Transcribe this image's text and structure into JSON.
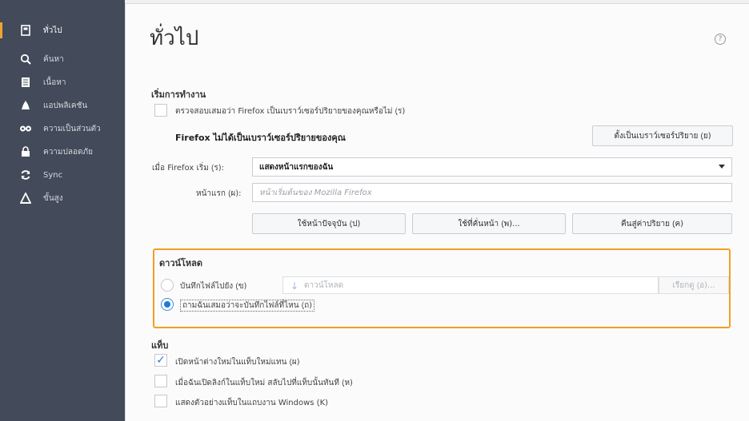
{
  "sidebar": {
    "items": [
      {
        "label": "ทั่วไป",
        "icon": "general-icon"
      },
      {
        "label": "ค้นหา",
        "icon": "search-icon"
      },
      {
        "label": "เนื้อหา",
        "icon": "content-icon"
      },
      {
        "label": "แอปพลิเคชัน",
        "icon": "applications-icon"
      },
      {
        "label": "ความเป็นส่วนตัว",
        "icon": "privacy-icon"
      },
      {
        "label": "ความปลอดภัย",
        "icon": "security-icon"
      },
      {
        "label": "Sync",
        "icon": "sync-icon"
      },
      {
        "label": "ขั้นสูง",
        "icon": "advanced-icon"
      }
    ]
  },
  "main": {
    "title": "ทั่วไป",
    "help": "?",
    "startup": {
      "title": "เริ่มการทำงาน",
      "check_default": "ตรวจสอบเสมอว่า Firefox เป็นเบราว์เซอร์ปริยายของคุณหรือไม่ (ฺร)",
      "not_default": "Firefox ไม่ได้เป็นเบราว์เซอร์ปริยายของคุณ",
      "make_default_button": "ตั้งเป็นเบราว์เซอร์ปริยาย (ฺย)",
      "when_starts_label": "เมื่อ Firefox เริ่ม (ฺร):",
      "when_starts_value": "แสดงหน้าแรกของฉัน",
      "homepage_label": "หน้าแรก (ฺผ):",
      "homepage_placeholder": "หน้าเริ่มต้นของ Mozilla Firefox",
      "use_current_button": "ใช้หน้าปัจจุบัน (ฺป)",
      "use_bookmark_button": "ใช้ที่คั่นหน้า (ฺพ)...",
      "restore_default_button": "คืนสู่ค่าปริยาย (ฺค)"
    },
    "downloads": {
      "title": "ดาวน์โหลด",
      "save_to_label": "บันทึกไฟล์ไปยัง (ฺข)",
      "save_to_value": "ดาวน์โหลด",
      "browse_button": "เรียกดู (ฺอ)...",
      "always_ask_label": "ถามฉันเสมอว่าจะบันทึกไฟล์ที่ไหน (ฺถ)"
    },
    "tabs": {
      "title": "แท็บ",
      "open_new_windows": "เปิดหน้าต่างใหม่ในแท็บใหม่แทน (ฺผ)",
      "switch_to_tab": "เมื่อฉันเปิดลิงก์ในแท็บใหม่ สลับไปที่แท็บนั้นทันที (ฺห)",
      "show_previews": "แสดงตัวอย่างแท็บในแถบงาน Windows (ฺK)"
    }
  },
  "colors": {
    "accent": "#1f7ad6",
    "highlight_border": "#f29e26",
    "sidebar_bg": "#434b5a"
  }
}
